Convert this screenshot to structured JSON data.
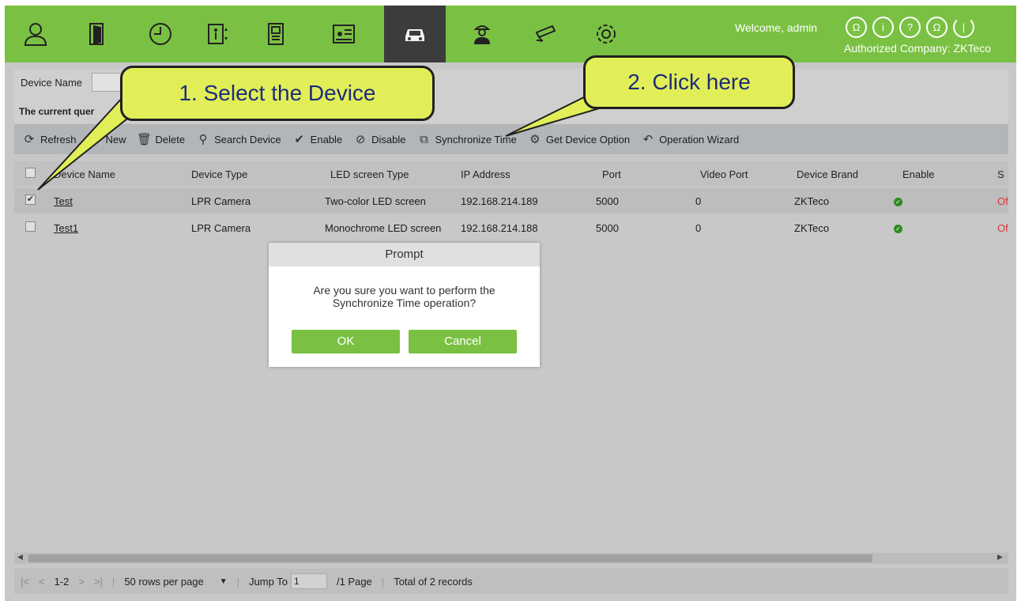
{
  "header": {
    "welcome": "Welcome, admin",
    "company": "Authorized Company: ZKTeco",
    "nav_icons": [
      "person-icon",
      "door-icon",
      "clock-icon",
      "elevator-icon",
      "building-icon",
      "id-card-icon",
      "car-icon",
      "visitor-icon",
      "camera-icon",
      "gear-icon"
    ],
    "active_index": 6,
    "header_icons": [
      "user-icon",
      "info-icon",
      "help-icon",
      "account-icon",
      "power-icon"
    ],
    "accent_color": "#7ac143"
  },
  "filter": {
    "label": "Device Name",
    "query_label": "The current quer"
  },
  "toolbar": {
    "refresh": "Refresh",
    "new": "New",
    "delete": "Delete",
    "search_device": "Search Device",
    "enable": "Enable",
    "disable": "Disable",
    "sync_time": "Synchronize Time",
    "get_option": "Get Device Option",
    "wizard": "Operation Wizard"
  },
  "table": {
    "headers": [
      "Device Name",
      "Device Type",
      "LED screen Type",
      "IP Address",
      "Port",
      "Video Port",
      "Device Brand",
      "Enable",
      "S"
    ],
    "rows": [
      {
        "checked": true,
        "name": "Test",
        "type": "LPR Camera",
        "led": "Two-color LED screen",
        "ip": "192.168.214.189",
        "port": "5000",
        "video_port": "0",
        "brand": "ZKTeco",
        "status": "Of"
      },
      {
        "checked": false,
        "name": "Test1",
        "type": "LPR Camera",
        "led": "Monochrome LED screen",
        "ip": "192.168.214.188",
        "port": "5000",
        "video_port": "0",
        "brand": "ZKTeco",
        "status": "Of"
      }
    ]
  },
  "pager": {
    "range": "1-2",
    "rows_per_page": "50 rows per page",
    "jump_label": "Jump To",
    "jump_value": "1",
    "pages": "/1 Page",
    "total": "Total of 2 records"
  },
  "dialog": {
    "title": "Prompt",
    "message_line1": "Are you sure you want to perform the",
    "message_line2": "Synchronize Time operation?",
    "ok": "OK",
    "cancel": "Cancel"
  },
  "callouts": {
    "step1": "1. Select the Device",
    "step2": "2. Click here"
  }
}
